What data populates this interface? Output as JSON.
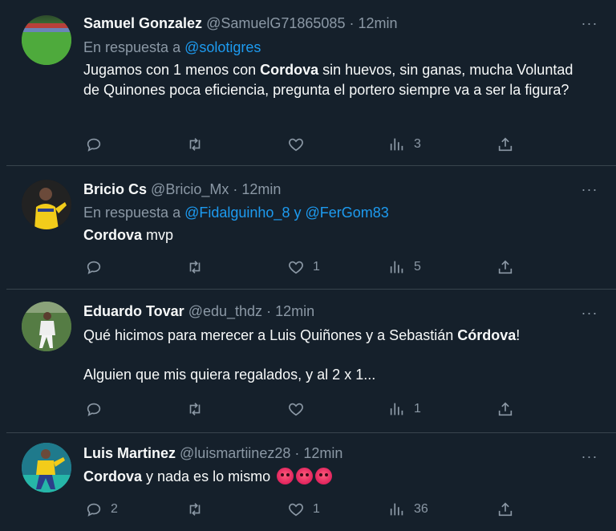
{
  "tweets": [
    {
      "name": "Samuel Gonzalez",
      "handle": "@SamuelG71865085",
      "time": "12min",
      "reply_label": "En respuesta a",
      "reply_to": [
        "@solotigres"
      ],
      "text": [
        {
          "t": "Jugamos con 1 menos con ",
          "b": false
        },
        {
          "t": "Cordova",
          "b": true
        },
        {
          "t": " sin huevos, sin ganas, mucha Voluntad de Quinones poca eficiencia, pregunta el portero siempre va a ser la figura?",
          "b": false
        }
      ],
      "replies": "",
      "retweets": "",
      "likes": "",
      "views": "3"
    },
    {
      "name": "Bricio Cs",
      "handle": "@Bricio_Mx",
      "time": "12min",
      "reply_label": "En respuesta a",
      "reply_to": [
        "@Fidalguinho_8",
        "@FerGom83"
      ],
      "reply_join": "y",
      "text": [
        {
          "t": "Cordova",
          "b": true
        },
        {
          "t": " mvp",
          "b": false
        }
      ],
      "replies": "",
      "retweets": "",
      "likes": "1",
      "views": "5"
    },
    {
      "name": "Eduardo Tovar",
      "handle": "@edu_thdz",
      "time": "12min",
      "text": [
        {
          "t": "Qué hicimos para merecer a Luis Quiñones y a Sebastián ",
          "b": false
        },
        {
          "t": "Córdova",
          "b": true
        },
        {
          "t": "!",
          "b": false
        }
      ],
      "text2": "Alguien que mis quiera regalados, y al 2 x 1...",
      "replies": "",
      "retweets": "",
      "likes": "",
      "views": "1"
    },
    {
      "name": "Luis Martinez",
      "handle": "@luismartiinez28",
      "time": "12min",
      "text": [
        {
          "t": "Cordova",
          "b": true
        },
        {
          "t": " y nada es lo mismo",
          "b": false
        }
      ],
      "emoji": "angry-face-emoji x3",
      "replies": "2",
      "retweets": "",
      "likes": "1",
      "views": "36"
    }
  ],
  "separator": "·",
  "more_label": "···",
  "colors": {
    "background": "#15202b",
    "muted": "#8b98a5",
    "link": "#1d9bf0",
    "border": "#38444d"
  },
  "icons": [
    "reply-icon",
    "retweet-icon",
    "like-icon",
    "views-icon",
    "share-icon"
  ]
}
